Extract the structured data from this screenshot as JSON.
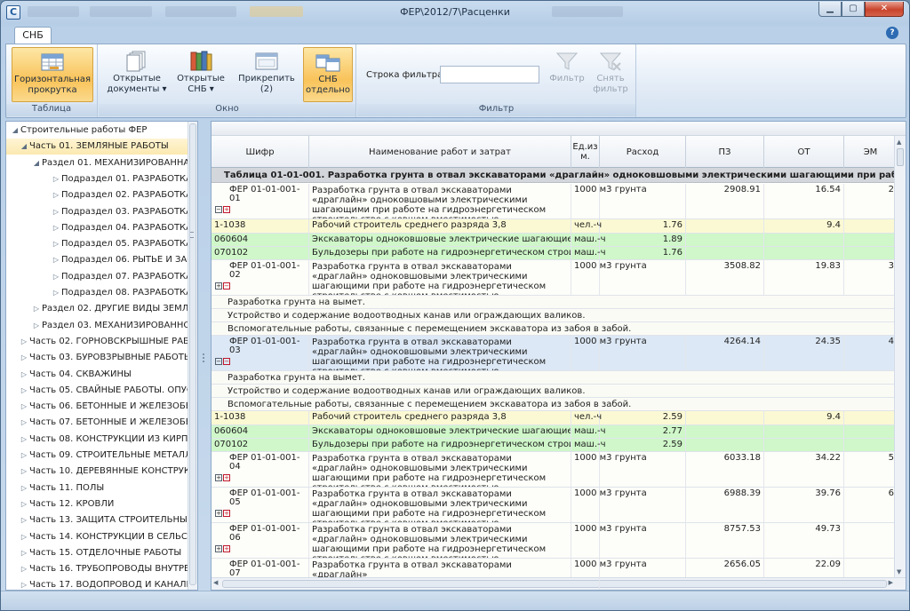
{
  "window": {
    "title": "ФЕР\\2012/7\\Расценки",
    "app_icon": "С"
  },
  "tabs": [
    {
      "label": "СНБ"
    }
  ],
  "ribbon": {
    "groups": [
      {
        "label": "Таблица",
        "buttons": [
          {
            "label": "Горизонтальная прокрутка",
            "icon": "table-scroll-icon",
            "active": true
          }
        ]
      },
      {
        "label": "Окно",
        "buttons": [
          {
            "label": "Открытые документы ▾",
            "icon": "documents-icon"
          },
          {
            "label": "Открытые СНБ ▾",
            "icon": "books-icon"
          },
          {
            "label": "Прикрепить (2)",
            "icon": "pin-window-icon"
          },
          {
            "label": "СНБ отдельно",
            "icon": "snb-separate-icon",
            "active": true
          }
        ]
      },
      {
        "label": "Фильтр",
        "filter_label": "Строка фильтра:",
        "filter_value": "",
        "buttons": [
          {
            "label": "Фильтр",
            "icon": "funnel-icon",
            "disabled": true
          },
          {
            "label": "Снять фильтр",
            "icon": "funnel-clear-icon",
            "disabled": true
          }
        ]
      }
    ]
  },
  "tree": {
    "items": [
      {
        "label": "Строительные работы ФЕР",
        "level": 0,
        "expanded": true
      },
      {
        "label": "Часть 01. ЗЕМЛЯНЫЕ РАБОТЫ",
        "level": 1,
        "expanded": true,
        "selected": true
      },
      {
        "label": "Раздел 01. МЕХАНИЗИРОВАННАЯ",
        "level": 2,
        "expanded": true
      },
      {
        "label": "Подраздел 01. РАЗРАБОТКА",
        "level": 3
      },
      {
        "label": "Подраздел 02. РАЗРАБОТКА",
        "level": 3
      },
      {
        "label": "Подраздел 03. РАЗРАБОТКА",
        "level": 3
      },
      {
        "label": "Подраздел 04. РАЗРАБОТКА",
        "level": 3
      },
      {
        "label": "Подраздел 05. РАЗРАБОТКА",
        "level": 3
      },
      {
        "label": "Подраздел 06. РЫТЬЕ И ЗАСЫ",
        "level": 3
      },
      {
        "label": "Подраздел 07. РАЗРАБОТКА",
        "level": 3
      },
      {
        "label": "Подраздел 08. РАЗРАБОТКА",
        "level": 3
      },
      {
        "label": "Раздел 02. ДРУГИЕ ВИДЫ ЗЕМЛЯ",
        "level": 2
      },
      {
        "label": "Раздел 03. МЕХАНИЗИРОВАННОЕ",
        "level": 2
      },
      {
        "label": "Часть 02. ГОРНОВСКРЫШНЫЕ РАБОТ",
        "level": 1
      },
      {
        "label": "Часть 03. БУРОВЗРЫВНЫЕ РАБОТЫ",
        "level": 1
      },
      {
        "label": "Часть 04. СКВАЖИНЫ",
        "level": 1
      },
      {
        "label": "Часть 05. СВАЙНЫЕ РАБОТЫ. ОПУСК",
        "level": 1
      },
      {
        "label": "Часть 06. БЕТОННЫЕ И ЖЕЛЕЗОБЕТО",
        "level": 1
      },
      {
        "label": "Часть 07. БЕТОННЫЕ И ЖЕЛЕЗОБЕТО",
        "level": 1
      },
      {
        "label": "Часть 08. КОНСТРУКЦИИ ИЗ КИРПИЧ",
        "level": 1
      },
      {
        "label": "Часть 09. СТРОИТЕЛЬНЫЕ МЕТАЛЛИЧ",
        "level": 1
      },
      {
        "label": "Часть 10. ДЕРЕВЯННЫЕ КОНСТРУКЦИ",
        "level": 1
      },
      {
        "label": "Часть 11. ПОЛЫ",
        "level": 1
      },
      {
        "label": "Часть 12. КРОВЛИ",
        "level": 1
      },
      {
        "label": "Часть 13. ЗАЩИТА СТРОИТЕЛЬНЫХ К",
        "level": 1
      },
      {
        "label": "Часть 14. КОНСТРУКЦИИ В СЕЛЬСКО",
        "level": 1
      },
      {
        "label": "Часть 15. ОТДЕЛОЧНЫЕ РАБОТЫ",
        "level": 1
      },
      {
        "label": "Часть 16. ТРУБОПРОВОДЫ ВНУТРЕНН",
        "level": 1
      },
      {
        "label": "Часть 17. ВОДОПРОВОД И КАНАЛИЗ.",
        "level": 1
      }
    ]
  },
  "grid": {
    "columns": [
      "Шифр",
      "Наименование работ и затрат",
      "Ед.из м.",
      "Расход",
      "ПЗ",
      "ОТ",
      "ЭМ"
    ],
    "table_header": "Таблица 01-01-001. Разработка грунта в отвал экскаваторами «драглайн» одноковшовыми электрическими шагающими при работе на гидроэнер",
    "rows": [
      {
        "type": "main",
        "code": "ФЕР 01-01-001-01",
        "name": "Разработка грунта в отвал экскаваторами «драглайн» одноковшовыми электрическими шагающими при работе на гидроэнергетическом строительстве с ковшом вместимостью …",
        "unit": "1000 м3 грунта",
        "qty": "",
        "pz": "2908.91",
        "ot": "16.54",
        "em": "2",
        "icons": "minus-plus"
      },
      {
        "type": "yel",
        "code": "1-1038",
        "name": "Рабочий строитель среднего разряда 3,8",
        "unit": "чел.-ч",
        "qty": "1.76",
        "pz": "",
        "ot": "9.4",
        "em": ""
      },
      {
        "type": "grn",
        "code": "060604",
        "name": "Экскаваторы одноковшовые электрические шагающие при ра…",
        "unit": "маш.-ч",
        "qty": "1.89",
        "pz": "",
        "ot": "",
        "em": ""
      },
      {
        "type": "grn",
        "code": "070102",
        "name": "Бульдозеры при работе на гидроэнергетическом строительст…",
        "unit": "маш.-ч",
        "qty": "1.76",
        "pz": "",
        "ot": "",
        "em": ""
      },
      {
        "type": "main",
        "code": "ФЕР 01-01-001-02",
        "name": "Разработка грунта в отвал экскаваторами «драглайн» одноковшовыми электрическими шагающими при работе на гидроэнергетическом строительстве с ковшом вместимостью …",
        "unit": "1000 м3 грунта",
        "qty": "",
        "pz": "3508.82",
        "ot": "19.83",
        "em": "3",
        "icons": "plus-minus"
      },
      {
        "type": "txt",
        "text": "Разработка грунта на вымет."
      },
      {
        "type": "txt",
        "text": "Устройство и содержание водоотводных канав или ограждающих валиков."
      },
      {
        "type": "txt",
        "text": "Вспомогательные работы, связанные с перемещением экскаватора из забоя в забой."
      },
      {
        "type": "hl",
        "code": "ФЕР 01-01-001-03",
        "name": "Разработка грунта в отвал экскаваторами «драглайн» одноковшовыми электрическими шагающими при работе на гидроэнергетическом строительстве с ковшом вместимостью …",
        "unit": "1000 м3 грунта",
        "qty": "",
        "pz": "4264.14",
        "ot": "24.35",
        "em": "4",
        "icons": "minus-minus"
      },
      {
        "type": "txt",
        "text": "Разработка грунта на вымет."
      },
      {
        "type": "txt",
        "text": "Устройство и содержание водоотводных канав или ограждающих валиков."
      },
      {
        "type": "txt",
        "text": "Вспомогательные работы, связанные с перемещением экскаватора из забоя в забой."
      },
      {
        "type": "yel",
        "code": "1-1038",
        "name": "Рабочий строитель среднего разряда 3,8",
        "unit": "чел.-ч",
        "qty": "2.59",
        "pz": "",
        "ot": "9.4",
        "em": ""
      },
      {
        "type": "grn",
        "code": "060604",
        "name": "Экскаваторы одноковшовые электрические шагающие при ра…",
        "unit": "маш.-ч",
        "qty": "2.77",
        "pz": "",
        "ot": "",
        "em": ""
      },
      {
        "type": "grn",
        "code": "070102",
        "name": "Бульдозеры при работе на гидроэнергетическом строительст…",
        "unit": "маш.-ч",
        "qty": "2.59",
        "pz": "",
        "ot": "",
        "em": ""
      },
      {
        "type": "main",
        "code": "ФЕР 01-01-001-04",
        "name": "Разработка грунта в отвал экскаваторами «драглайн» одноковшовыми электрическими шагающими при работе на гидроэнергетическом строительстве с ковшом вместимостью …",
        "unit": "1000 м3 грунта",
        "qty": "",
        "pz": "6033.18",
        "ot": "34.22",
        "em": "5",
        "icons": "plus-plus"
      },
      {
        "type": "main",
        "code": "ФЕР 01-01-001-05",
        "name": "Разработка грунта в отвал экскаваторами «драглайн» одноковшовыми электрическими шагающими при работе на гидроэнергетическом строительстве с ковшом вместимостью …",
        "unit": "1000 м3 грунта",
        "qty": "",
        "pz": "6988.39",
        "ot": "39.76",
        "em": "6",
        "icons": "plus-plus"
      },
      {
        "type": "main",
        "code": "ФЕР 01-01-001-06",
        "name": "Разработка грунта в отвал экскаваторами «драглайн» одноковшовыми электрическими шагающими при работе на гидроэнергетическом строительстве с ковшом вместимостью …",
        "unit": "1000 м3 грунта",
        "qty": "",
        "pz": "8757.53",
        "ot": "49.73",
        "em": "",
        "icons": "plus-plus"
      },
      {
        "type": "main",
        "code": "ФЕР 01-01-001-07",
        "name": "Разработка грунта в отвал экскаваторами «драглайн»",
        "unit": "1000 м3 грунта",
        "qty": "",
        "pz": "2656.05",
        "ot": "22.09",
        "em": "",
        "icons": ""
      }
    ]
  },
  "colors": {
    "accent": "#f9c35a",
    "yellow_row": "#fbf9d3",
    "green_row": "#cff7c9",
    "selected_row": "#dce8f5"
  }
}
